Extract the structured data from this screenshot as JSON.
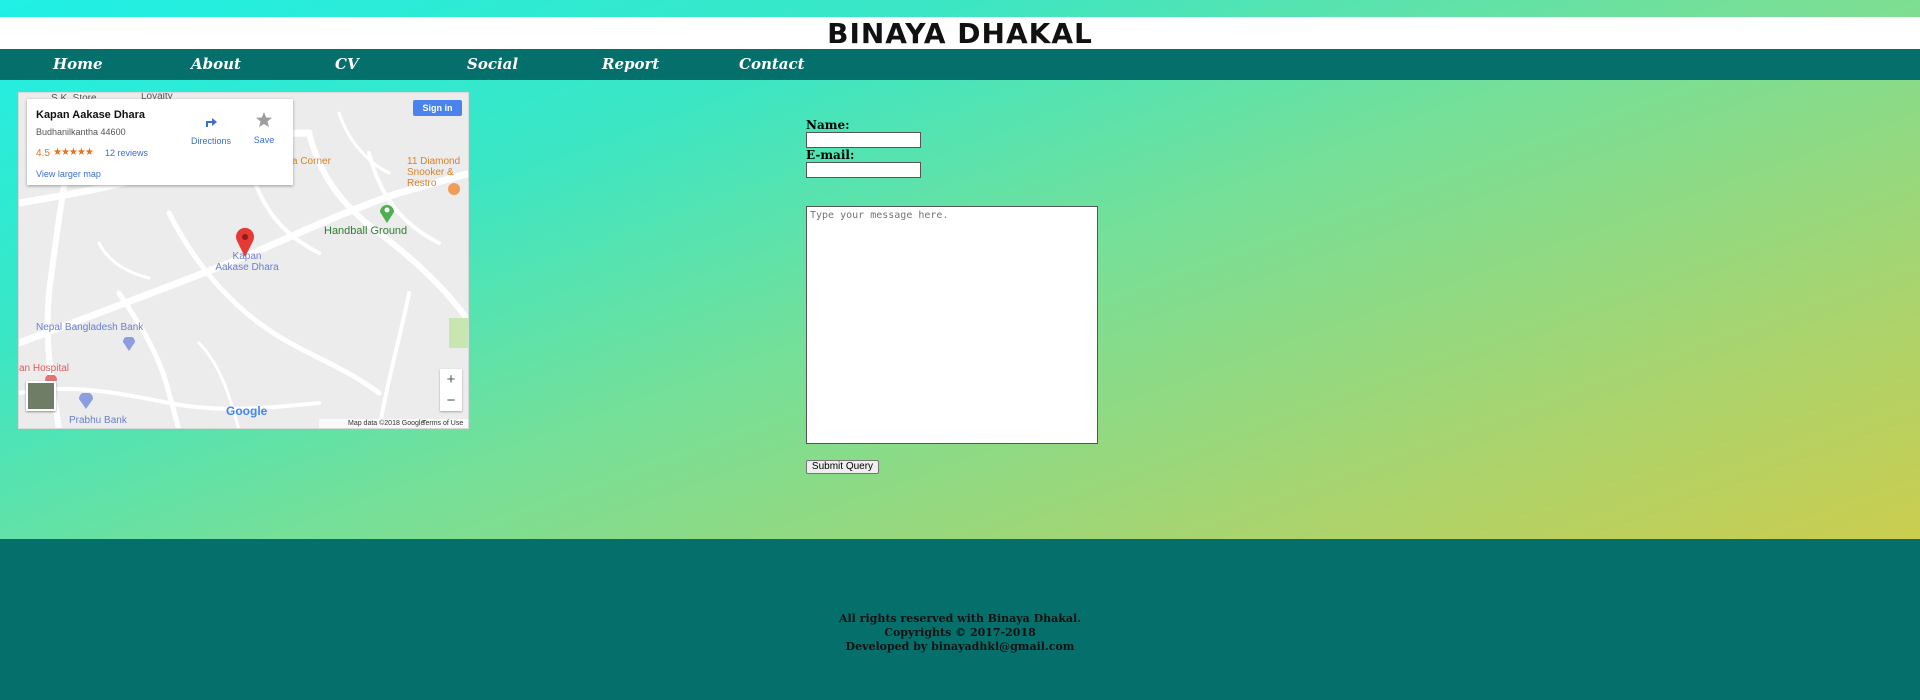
{
  "header": {
    "title": "BINAYA DHAKAL"
  },
  "nav": {
    "items": [
      {
        "label": "Home"
      },
      {
        "label": "About"
      },
      {
        "label": "CV"
      },
      {
        "label": "Social"
      },
      {
        "label": "Report"
      },
      {
        "label": "Contact"
      }
    ]
  },
  "map": {
    "place_name": "Kapan Aakase Dhara",
    "address": "Budhanilkantha 44600",
    "rating": "4.5",
    "stars": "★★★★★",
    "reviews": "12 reviews",
    "view_larger": "View larger map",
    "directions": "Directions",
    "save": "Save",
    "sign_in": "Sign in",
    "zoom_in": "+",
    "zoom_out": "−",
    "google": "Google",
    "map_data": "Map data ©2018 Google",
    "terms": "Terms of Use",
    "pin_label": "Kapan Aakase Dhara",
    "labels": {
      "sk_store": "S.K. Store",
      "loyalty": "Loyalty",
      "corner": "a Corner",
      "snooker": "11 Diamond Snooker & Restro",
      "handball": "Handball Ground",
      "bank1": "Nepal Bangladesh Bank",
      "hospital": "an Hospital",
      "bank2": "Prabhu Bank"
    }
  },
  "form": {
    "name_label": "Name:",
    "email_label": "E-mail:",
    "message_placeholder": "Type your message here.",
    "submit_label": "Submit Query"
  },
  "footer": {
    "line1": "All rights reserved with Binaya Dhakal.",
    "line2": "Copyrights © 2017-2018",
    "line3": "Developed by binayadhkl@gmail.com"
  },
  "colors": {
    "nav_bg": "#056f6b",
    "footer_bg": "#056f6b",
    "gradient_start": "#1ff0e6",
    "gradient_end": "#e1c93b",
    "map_link": "#3a6fd6",
    "rating": "#e7711b",
    "pin": "#e53935"
  },
  "icons": {
    "directions": "directions-arrow-icon",
    "save": "star-icon",
    "pin": "map-pin-icon",
    "satellite": "satellite-thumbnail-icon"
  }
}
